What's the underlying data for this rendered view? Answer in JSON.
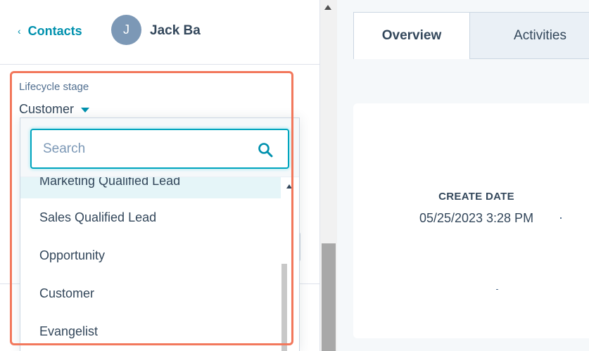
{
  "header": {
    "back_label": "Contacts",
    "back_icon": "chevron-left-icon",
    "avatar_initial": "J",
    "contact_name": "Jack Ba"
  },
  "lifecycle": {
    "label": "Lifecycle stage",
    "value": "Customer"
  },
  "dropdown": {
    "search_placeholder": "Search",
    "search_icon": "search-icon",
    "options": [
      "Marketing Qualified Lead",
      "Sales Qualified Lead",
      "Opportunity",
      "Customer",
      "Evangelist"
    ]
  },
  "tabs": [
    {
      "label": "Overview",
      "active": true
    },
    {
      "label": "Activities",
      "active": false
    }
  ],
  "card": {
    "label": "CREATE DATE",
    "value": "05/25/2023 3:28 PM"
  },
  "colors": {
    "accent": "#0091ae",
    "highlight": "#f2785c",
    "avatar": "#7c98b6",
    "focus_border": "#00a4bd"
  }
}
